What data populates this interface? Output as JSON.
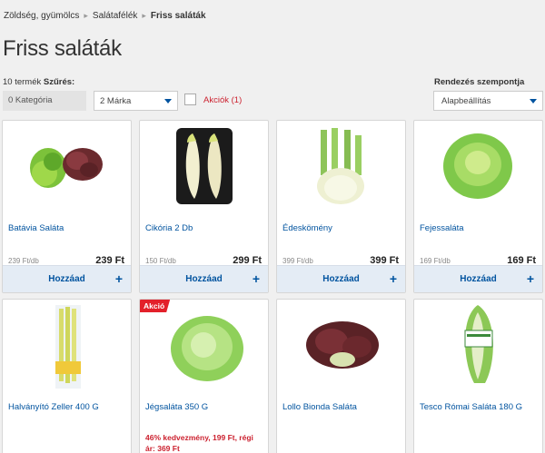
{
  "breadcrumb": [
    "Zöldség, gyümölcs",
    "Salátafélék",
    "Friss saláták"
  ],
  "page_title": "Friss saláták",
  "filters": {
    "count": "10 termék",
    "filter_label": "Szűrés:",
    "category": "0 Kategória",
    "brand": "2 Márka",
    "promo": "Akciók (1)"
  },
  "sort": {
    "label": "Rendezés szempontja",
    "value": "Alapbeállítás"
  },
  "colors": {
    "link_blue": "#00539f",
    "sale_red": "#e3202a",
    "promo_red": "#cc2230"
  },
  "products": [
    {
      "name": "Batávia Saláta",
      "unit_price": "239 Ft/db",
      "price": "239 Ft",
      "add": "Hozzáad"
    },
    {
      "name": "Cikória 2 Db",
      "unit_price": "150 Ft/db",
      "price": "299 Ft",
      "add": "Hozzáad"
    },
    {
      "name": "Édeskömény",
      "unit_price": "399 Ft/db",
      "price": "399 Ft",
      "add": "Hozzáad"
    },
    {
      "name": "Fejessaláta",
      "unit_price": "169 Ft/db",
      "price": "169 Ft",
      "add": "Hozzáad"
    },
    {
      "name": "Halványító Zeller 400 G"
    },
    {
      "name": "Jégsaláta 350 G",
      "badge": "Akció",
      "promo": "46% kedvezmény, 199 Ft, régi ár: 369 Ft"
    },
    {
      "name": "Lollo Bionda Saláta"
    },
    {
      "name": "Tesco Római Saláta 180 G"
    }
  ]
}
